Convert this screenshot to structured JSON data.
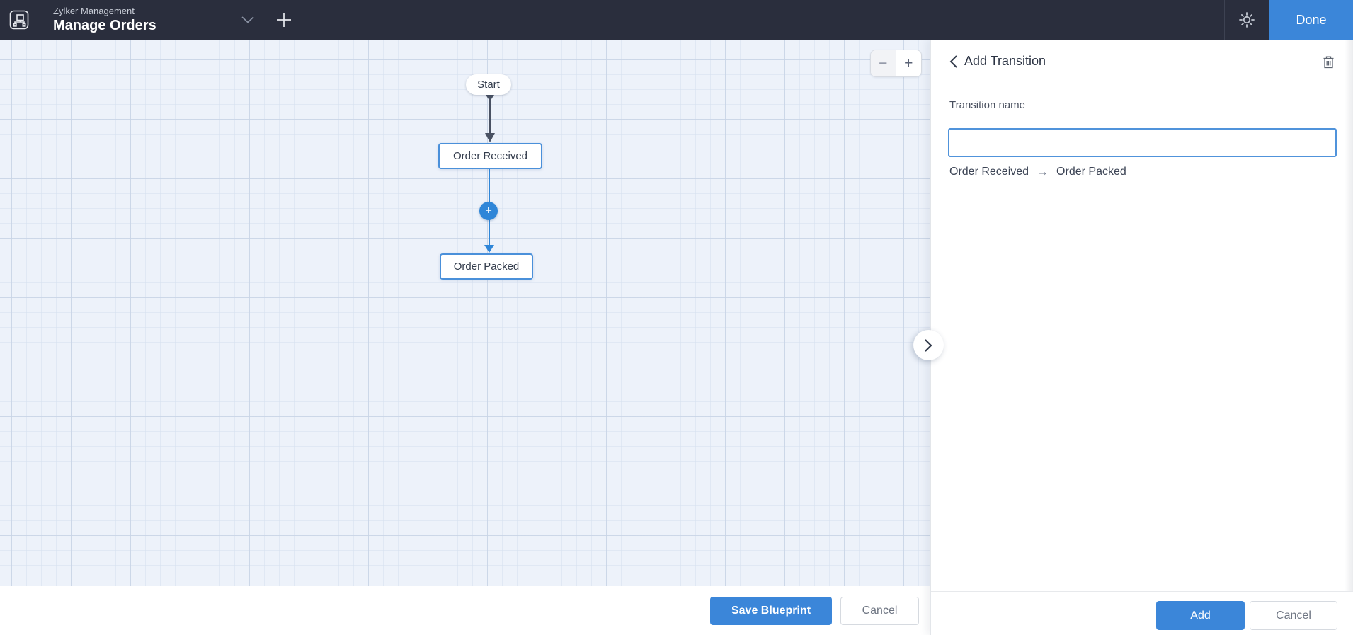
{
  "topbar": {
    "workspace": "Zylker Management",
    "blueprint_title": "Manage Orders",
    "done_label": "Done"
  },
  "canvas": {
    "zoom_out_glyph": "−",
    "zoom_in_glyph": "+",
    "add_node_glyph": "+",
    "nodes": {
      "start": "Start",
      "received": "Order Received",
      "packed": "Order Packed"
    },
    "footer": {
      "save_label": "Save Blueprint",
      "cancel_label": "Cancel"
    }
  },
  "panel": {
    "title": "Add Transition",
    "field_label": "Transition name",
    "field_value": "",
    "route": {
      "from": "Order Received",
      "arrow": "→",
      "to": "Order Packed"
    },
    "footer": {
      "add_label": "Add",
      "cancel_label": "Cancel"
    }
  },
  "icons": {
    "logo": "blueprint-flowchart",
    "workspace_dropdown": "chevron-down",
    "new_blueprint": "plus",
    "settings": "gear",
    "panel_back": "chevron-left",
    "delete_transition": "trash",
    "collapse_panel": "chevron-right",
    "transition_add": "plus"
  },
  "colors": {
    "topbar_bg": "#2a2e3d",
    "accent_blue": "#3b86d9",
    "node_border": "#4a90da",
    "grid_bg": "#edf2fa",
    "dark_connector": "#4a5263",
    "blue_connector": "#2f86d8"
  }
}
